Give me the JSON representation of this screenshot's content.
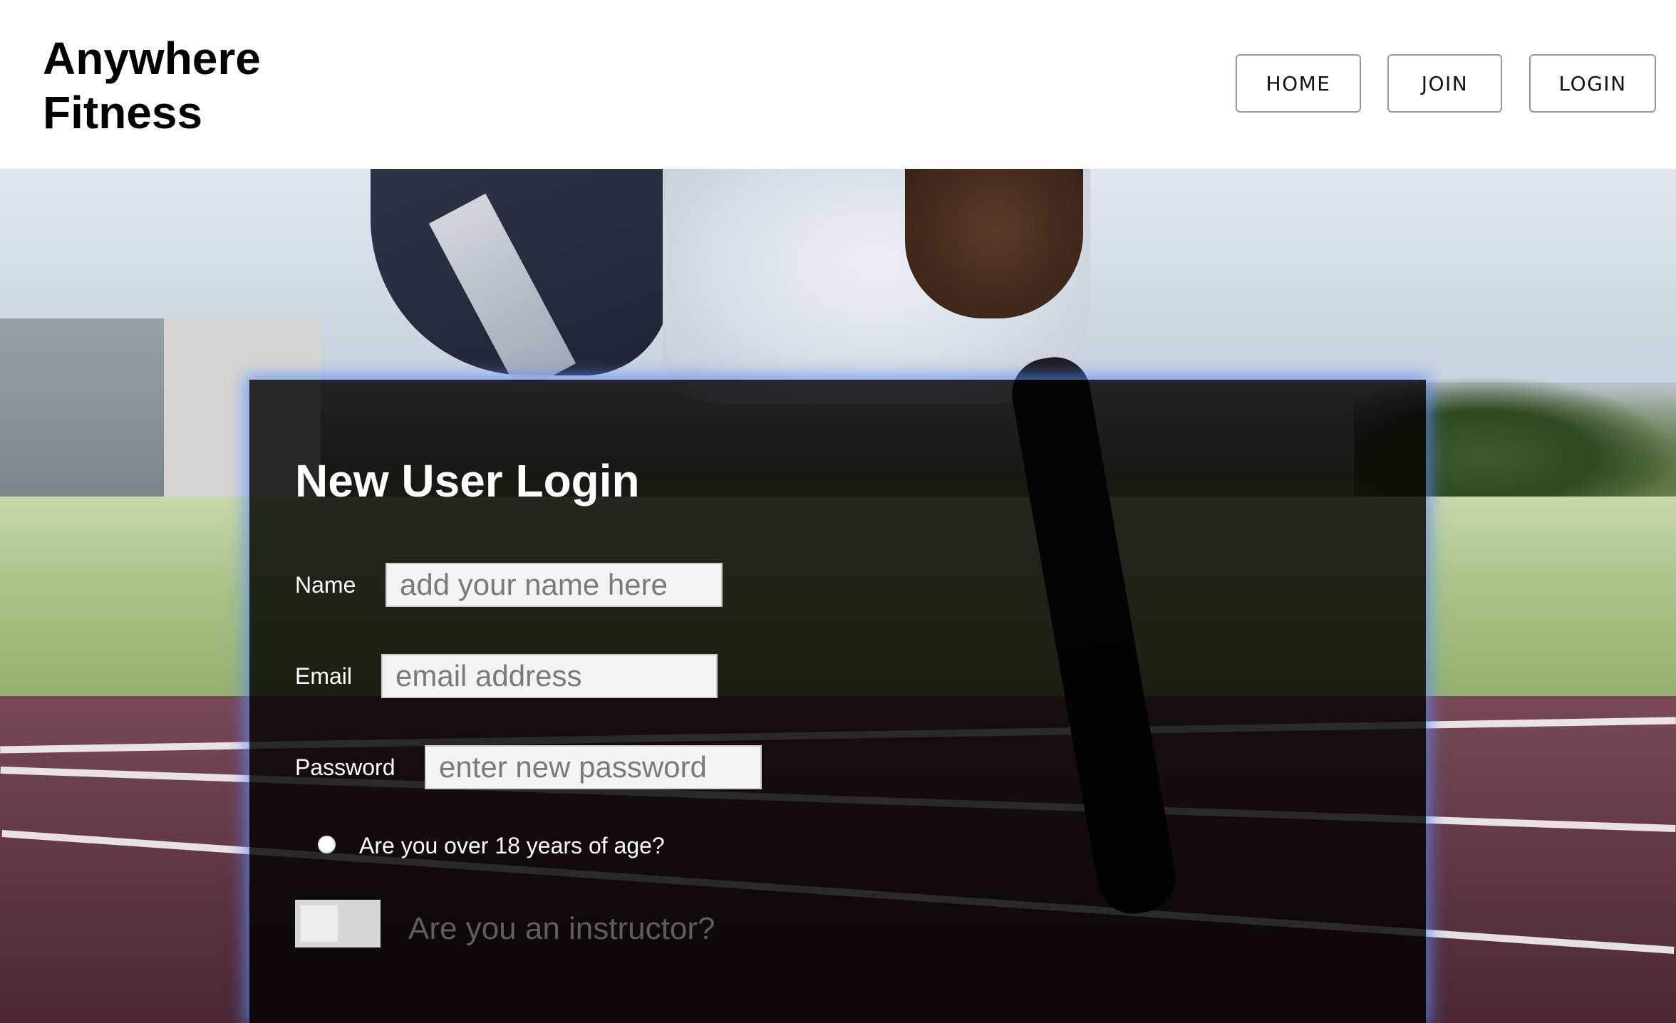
{
  "header": {
    "brand_line1": "Anywhere",
    "brand_line2": "Fitness",
    "nav": {
      "home": "HOME",
      "join": "JOIN",
      "login": "LOGIN"
    }
  },
  "form": {
    "title": "New User Login",
    "name": {
      "label": "Name",
      "placeholder": "add your name here",
      "value": ""
    },
    "email": {
      "label": "Email",
      "placeholder": "email address",
      "value": ""
    },
    "password": {
      "label": "Password",
      "placeholder": "enter new password",
      "value": ""
    },
    "age_radio": {
      "label": "Are you over 18 years of age?",
      "checked": false
    },
    "instructor_toggle": {
      "label": "Are you an instructor?",
      "on": false
    }
  },
  "colors": {
    "card_background": "#000000",
    "card_glow": "#5a8cff",
    "header_background": "#ffffff",
    "nav_border": "#9a9a9a"
  }
}
